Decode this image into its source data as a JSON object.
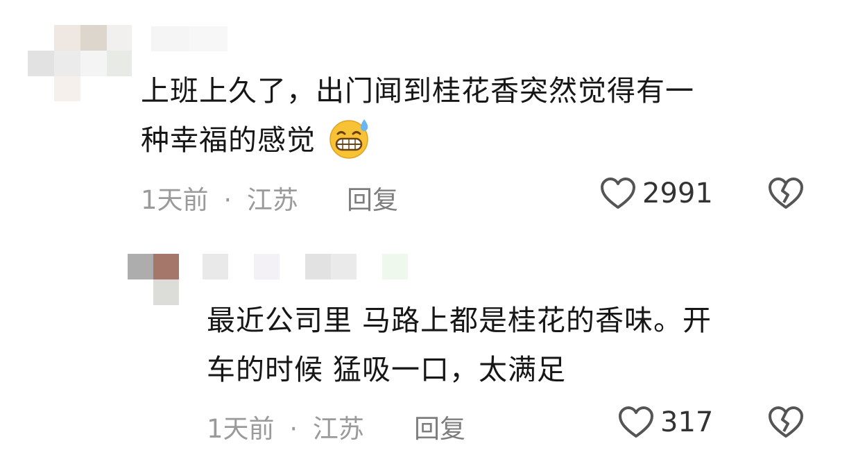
{
  "comments": [
    {
      "text_line1": "上班上久了，出门闻到桂花香突然觉得有一",
      "text_line2": "种幸福的感觉",
      "emoji": "grinning-sweat-emoji",
      "time": "1天前",
      "separator": "·",
      "location": "江苏",
      "reply_label": "回复",
      "likes": "2991"
    },
    {
      "text_line1": "最近公司里 马路上都是桂花的香味。开",
      "text_line2": "车的时候 猛吸一口，太满足",
      "time": "1天前",
      "separator": "·",
      "location": "江苏",
      "reply_label": "回复",
      "likes": "317"
    }
  ],
  "icons": {
    "like": "heart-outline-icon",
    "dislike": "broken-heart-icon"
  },
  "colors": {
    "text": "#161616",
    "meta": "#9a9a9a",
    "icon": "#555555"
  }
}
